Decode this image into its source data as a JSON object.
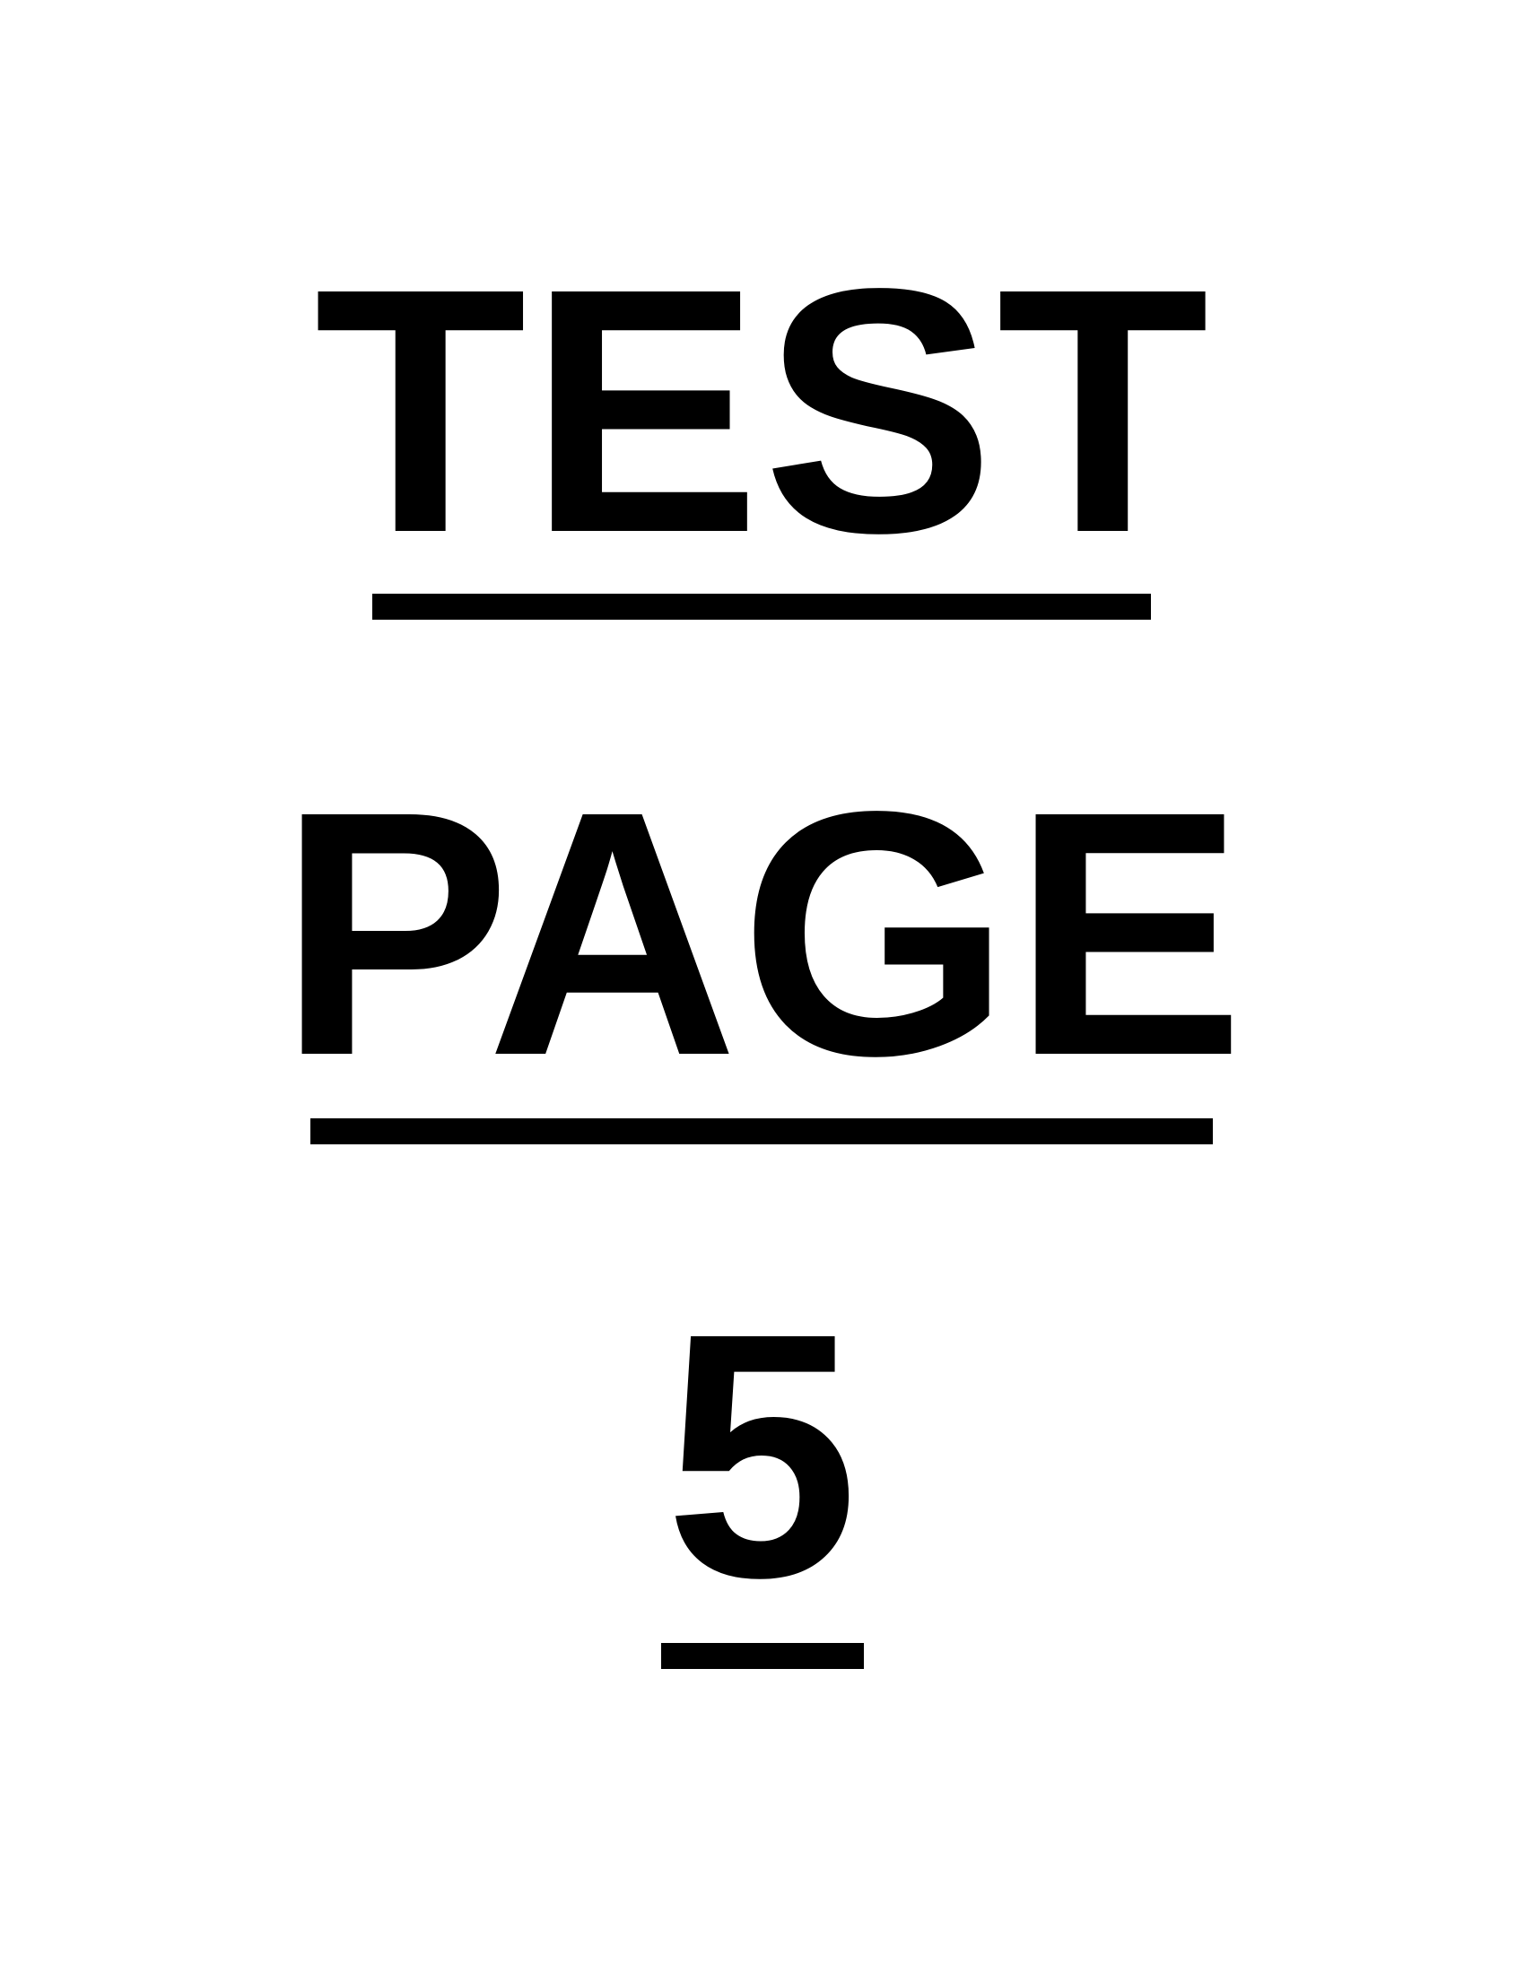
{
  "document": {
    "lines": [
      {
        "text": "TEST"
      },
      {
        "text": "PAGE"
      },
      {
        "text": "5"
      }
    ],
    "text_color": "#000000",
    "background_color": "#ffffff"
  }
}
